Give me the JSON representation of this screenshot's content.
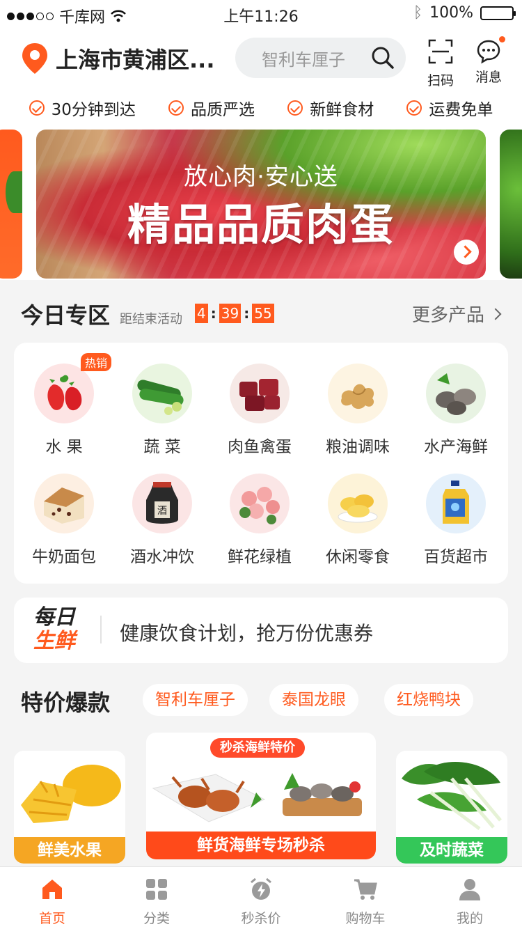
{
  "status": {
    "carrier": "千库网",
    "time": "上午11:26",
    "battery": "100%"
  },
  "header": {
    "location": "上海市黄浦区...",
    "search_placeholder": "智利车厘子",
    "scan_label": "扫码",
    "message_label": "消息"
  },
  "features": [
    "30分钟到达",
    "品质严选",
    "新鲜食材",
    "运费免单"
  ],
  "banner": {
    "subtitle": "放心肉·安心送",
    "title": "精品品质肉蛋"
  },
  "today": {
    "title": "今日专区",
    "ends_label": "距结束活动",
    "hours": "4",
    "minutes": "39",
    "seconds": "55",
    "more": "更多产品"
  },
  "categories": {
    "hot_badge": "热销",
    "items": [
      {
        "label": "水 果",
        "icon": "strawberry-icon"
      },
      {
        "label": "蔬 菜",
        "icon": "cucumber-icon"
      },
      {
        "label": "肉鱼禽蛋",
        "icon": "meat-icon"
      },
      {
        "label": "粮油调味",
        "icon": "ginger-icon"
      },
      {
        "label": "水产海鲜",
        "icon": "clam-icon"
      },
      {
        "label": "牛奶面包",
        "icon": "bread-icon"
      },
      {
        "label": "酒水冲饮",
        "icon": "wine-jar-icon"
      },
      {
        "label": "鲜花绿植",
        "icon": "roses-icon"
      },
      {
        "label": "休闲零食",
        "icon": "chips-icon"
      },
      {
        "label": "百货超市",
        "icon": "detergent-icon"
      }
    ]
  },
  "daily": {
    "logo_line1": "每日",
    "logo_line2": "生鲜",
    "text": "健康饮食计划，抢万份优惠券"
  },
  "specials": {
    "title": "特价爆款",
    "chips": [
      "智利车厘子",
      "泰国龙眼",
      "红烧鸭块"
    ]
  },
  "products": {
    "left": "鲜美水果",
    "center_tag": "秒杀海鲜特价",
    "center": "鲜货海鲜专场秒杀",
    "right": "及时蔬菜"
  },
  "tabs": [
    "首页",
    "分类",
    "秒杀价",
    "购物车",
    "我的"
  ],
  "colors": {
    "accent": "#ff5a1e",
    "fruit_bar": "#f5a623",
    "veg_bar": "#34c759"
  }
}
